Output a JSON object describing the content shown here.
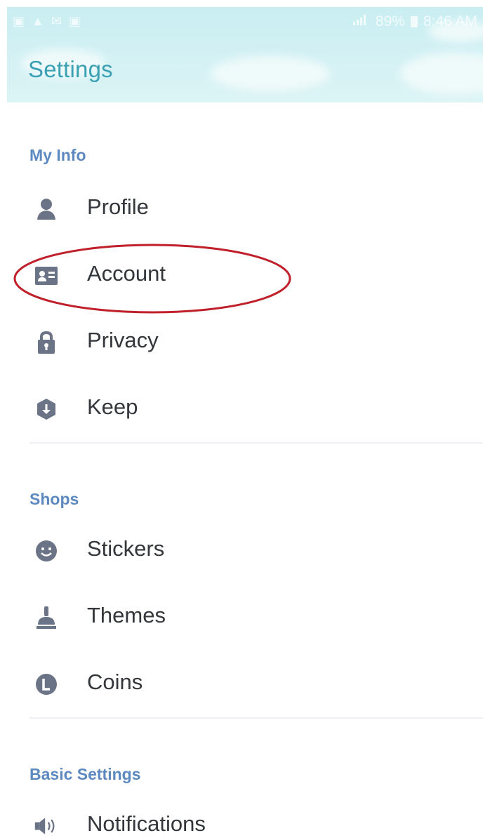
{
  "status_bar": {
    "left_icons": [
      "▣",
      "▲",
      "✉",
      "▣"
    ],
    "signal": "📶",
    "battery": "89%",
    "time": "8:46 AM"
  },
  "header": {
    "title": "Settings"
  },
  "sections": {
    "my_info": {
      "label": "My Info",
      "items": {
        "profile": "Profile",
        "account": "Account",
        "privacy": "Privacy",
        "keep": "Keep"
      }
    },
    "shops": {
      "label": "Shops",
      "items": {
        "stickers": "Stickers",
        "themes": "Themes",
        "coins": "Coins"
      }
    },
    "basic_settings": {
      "label": "Basic Settings",
      "items": {
        "notifications": "Notifications"
      }
    }
  },
  "icon_color": "#6b7387",
  "accent_color": "#5d89c1",
  "annotation_color": "#c0202a",
  "icons": {
    "profile": "person-icon",
    "account": "id-card-icon",
    "privacy": "lock-icon",
    "keep": "keep-download-icon",
    "stickers": "smiley-icon",
    "themes": "paint-brush-icon",
    "coins": "coin-icon",
    "notifications": "speaker-icon"
  }
}
